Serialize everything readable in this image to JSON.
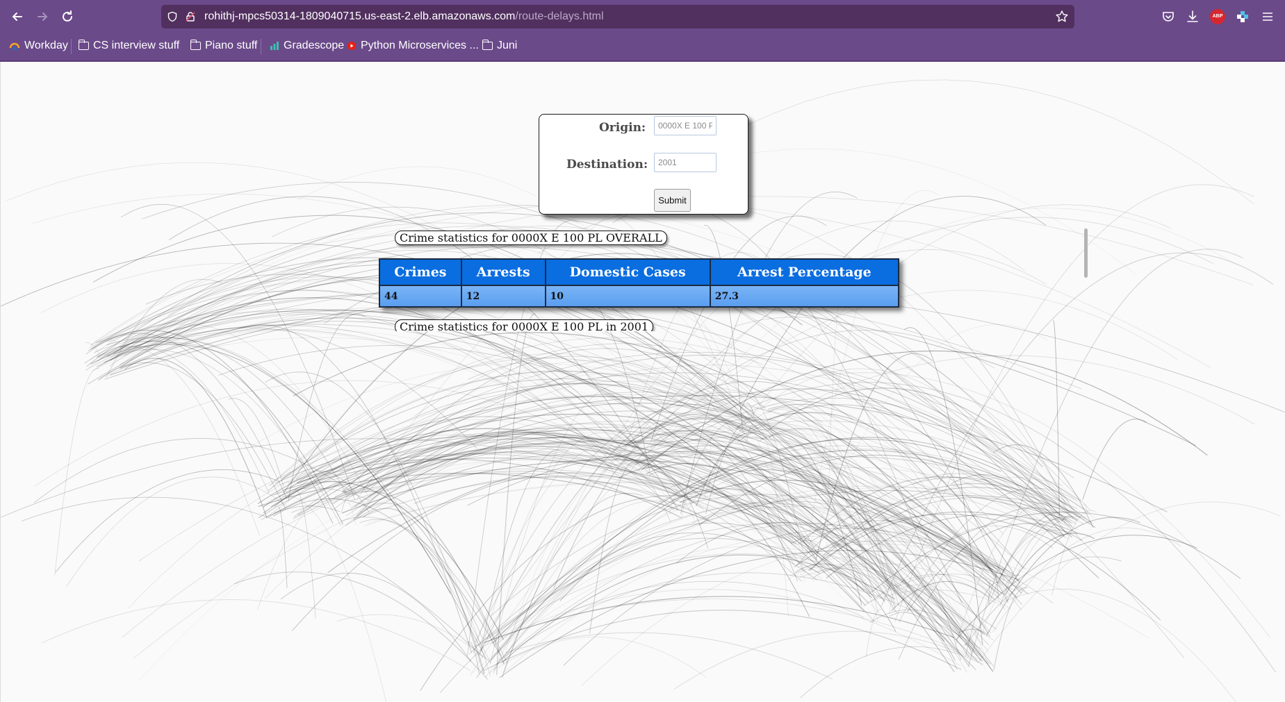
{
  "browser": {
    "url_host": "rohithj-mpcs50314-1809040715.us-east-2.elb.amazonaws.com",
    "url_path": "/route-delays.html",
    "bookmarks": [
      {
        "label": "Workday",
        "icon": "workday-icon"
      },
      {
        "label": "CS  interview  stuff",
        "icon": "folder-icon"
      },
      {
        "label": "Piano  stuff",
        "icon": "folder-icon"
      },
      {
        "label": "Gradescope",
        "icon": "gradescope-icon"
      },
      {
        "label": "Python  Microservices  ...",
        "icon": "youtube-icon"
      },
      {
        "label": "Juni",
        "icon": "folder-icon"
      }
    ],
    "extension_abp_label": "ABP"
  },
  "form": {
    "origin_label": "Origin:",
    "origin_value": "0000X E 100 PL",
    "destination_label": "Destination:",
    "destination_value": "2001",
    "submit_label": "Submit"
  },
  "results": {
    "overall_caption": "Crime statistics for 0000X E 100 PL OVERALL",
    "columns": [
      "Crimes",
      "Arrests",
      "Domestic Cases",
      "Arrest Percentage"
    ],
    "overall_row": [
      "44",
      "12",
      "10",
      "27.3"
    ],
    "year_caption": "Crime statistics for 0000X E 100 PL in 2001"
  },
  "colors": {
    "browser_chrome": "#6b4a8a",
    "table_header": "#0a6de0",
    "table_row": "#6aa8f4"
  }
}
